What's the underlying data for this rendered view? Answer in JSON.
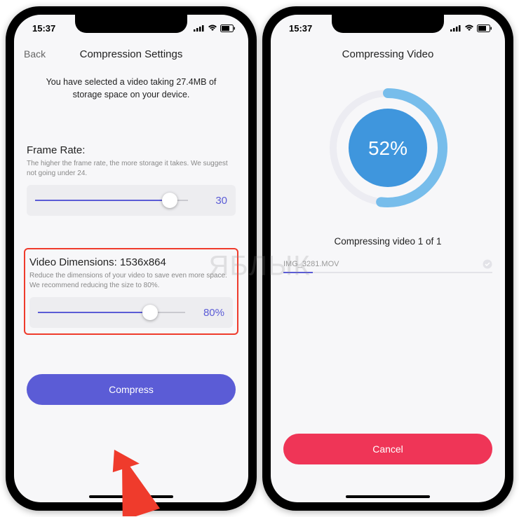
{
  "status": {
    "time": "15:37"
  },
  "left": {
    "back": "Back",
    "title": "Compression Settings",
    "subtitle": "You have selected a video taking 27.4MB of storage space on your device.",
    "frame": {
      "title": "Frame Rate:",
      "desc": "The higher the frame rate, the more storage it takes. We suggest not going under 24.",
      "value": "30",
      "pct": 88
    },
    "dim": {
      "title": "Video Dimensions: 1536x864",
      "desc": "Reduce the dimensions of your video to save even more space. We recommend reducing the size to 80%.",
      "value": "80%",
      "pct": 76
    },
    "cta": "Compress"
  },
  "right": {
    "title": "Compressing Video",
    "percent": "52%",
    "ring_pct": 52,
    "status": "Compressing video 1 of 1",
    "file": "IMG_3281.MOV",
    "file_pct": 14,
    "cancel": "Cancel"
  },
  "watermark": "ЯБЛЫК"
}
